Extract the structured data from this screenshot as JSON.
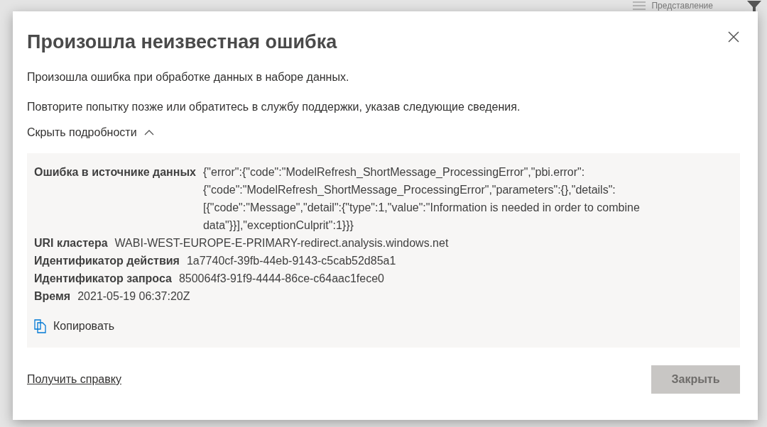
{
  "background": {
    "view_label": "Представление"
  },
  "dialog": {
    "title": "Произошла неизвестная ошибка",
    "messages": [
      "Произошла ошибка при обработке данных в наборе данных.",
      "Повторите попытку позже или обратитесь в службу поддержки, указав следующие сведения."
    ],
    "details_toggle": {
      "label": "Скрыть подробности",
      "expanded": true
    },
    "details": [
      {
        "label": "Ошибка в источнике данных",
        "value": "{\"error\":{\"code\":\"ModelRefresh_ShortMessage_ProcessingError\",\"pbi.error\":{\"code\":\"ModelRefresh_ShortMessage_ProcessingError\",\"parameters\":{},\"details\":[{\"code\":\"Message\",\"detail\":{\"type\":1,\"value\":\"Information is needed in order to combine data\"}}],\"exceptionCulprit\":1}}}"
      },
      {
        "label": "URI кластера",
        "value": "WABI-WEST-EUROPE-E-PRIMARY-redirect.analysis.windows.net"
      },
      {
        "label": "Идентификатор действия",
        "value": "1a7740cf-39fb-44eb-9143-c5cab52d85a1"
      },
      {
        "label": "Идентификатор запроса",
        "value": "850064f3-91f9-4444-86ce-c64aac1fece0"
      },
      {
        "label": "Время",
        "value": "2021-05-19 06:37:20Z"
      }
    ],
    "copy_label": "Копировать",
    "help_link": "Получить справку",
    "close_button": {
      "label": "Закрыть",
      "disabled": true
    }
  }
}
